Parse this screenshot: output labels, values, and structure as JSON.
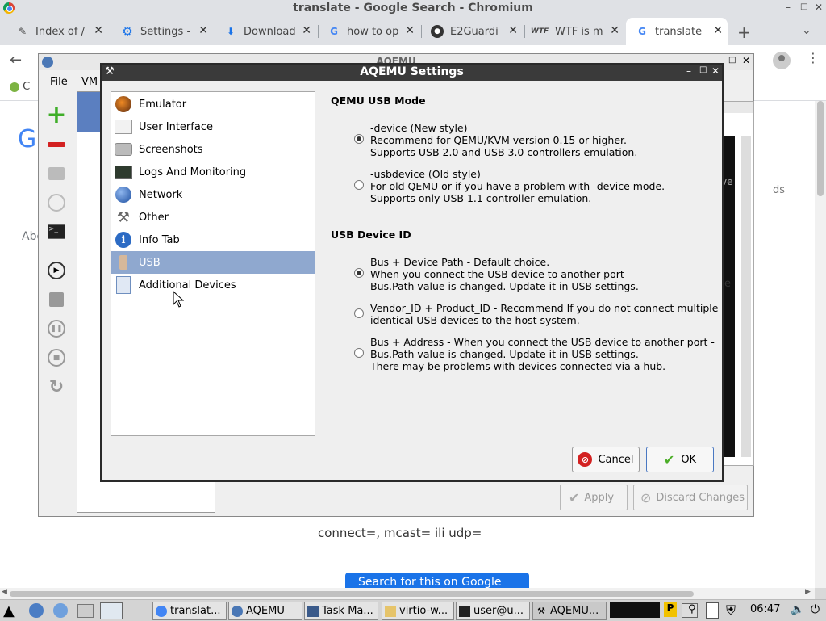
{
  "browser": {
    "window_title": "translate - Google Search - Chromium",
    "tabs": [
      {
        "label": "Index of /",
        "icon": "broom-icon"
      },
      {
        "label": "Settings -",
        "icon": "gear-icon"
      },
      {
        "label": "Download",
        "icon": "download-icon"
      },
      {
        "label": "how to op",
        "icon": "google-icon"
      },
      {
        "label": "E2Guardi",
        "icon": "github-icon"
      },
      {
        "label": "WTF is m",
        "icon": "wtf-icon"
      },
      {
        "label": "translate",
        "icon": "google-icon"
      }
    ],
    "new_tab": "+",
    "bookmark_fragment": "C",
    "page_fragments": {
      "ab": "Abo",
      "connect": "connect=, mcast= ili udp=",
      "search_btn": "Search for this on Google"
    }
  },
  "aqemu": {
    "window_title": "AQEMU",
    "menu": [
      "File",
      "VM"
    ],
    "buttons": {
      "apply": "Apply",
      "discard": "Discard Changes"
    },
    "right_frag": [
      "ve",
      "ds",
      "e"
    ]
  },
  "dialog": {
    "title": "AQEMU Settings",
    "categories": [
      {
        "label": "Emulator",
        "icon": "emulator-icon"
      },
      {
        "label": "User Interface",
        "icon": "user-interface-icon"
      },
      {
        "label": "Screenshots",
        "icon": "camera-icon"
      },
      {
        "label": "Logs And Monitoring",
        "icon": "monitor-icon"
      },
      {
        "label": "Network",
        "icon": "network-icon"
      },
      {
        "label": "Other",
        "icon": "tools-icon"
      },
      {
        "label": "Info Tab",
        "icon": "info-icon"
      },
      {
        "label": "USB",
        "icon": "usb-icon"
      },
      {
        "label": "Additional Devices",
        "icon": "devices-icon"
      }
    ],
    "selected_category": "USB",
    "usb_mode": {
      "title": "QEMU USB Mode",
      "options": [
        {
          "lines": [
            "-device (New style)",
            "Recommend for QEMU/KVM version 0.15 or higher.",
            "Supports USB 2.0 and USB 3.0 controllers emulation."
          ],
          "checked": true
        },
        {
          "lines": [
            "-usbdevice (Old style)",
            "For old QEMU or if you have a problem with -device mode.",
            "Supports only USB 1.1 controller emulation."
          ],
          "checked": false
        }
      ]
    },
    "usb_id": {
      "title": "USB Device ID",
      "options": [
        {
          "lines": [
            "Bus + Device Path - Default choice.",
            "When you connect the USB device to another port -",
            "Bus.Path value is changed. Update it in USB settings."
          ],
          "checked": true
        },
        {
          "lines": [
            "Vendor_ID + Product_ID - Recommend If you do not connect multiple",
            "identical USB devices to the host system."
          ],
          "checked": false
        },
        {
          "lines": [
            "Bus + Address - When you connect the USB device to another port -",
            "Bus.Path value is changed. Update it in USB settings.",
            "There may be problems with devices connected via a hub."
          ],
          "checked": false
        }
      ]
    },
    "cancel": "Cancel",
    "ok": "OK"
  },
  "taskbar": {
    "tasks": [
      {
        "label": "translat...",
        "icon": "chromium-icon"
      },
      {
        "label": "AQEMU",
        "icon": "aqemu-icon"
      },
      {
        "label": "Task Ma...",
        "icon": "task-manager-icon"
      },
      {
        "label": "virtio-w...",
        "icon": "folder-icon"
      },
      {
        "label": "user@u...",
        "icon": "terminal-icon"
      },
      {
        "label": "AQEMU...",
        "icon": "tools-icon"
      }
    ],
    "clock": "06:47"
  },
  "colors": {
    "dialog_title_bg": "#3a3a3a",
    "selected_bg": "#8fa8cf",
    "google_blue": "#1a73e8"
  }
}
